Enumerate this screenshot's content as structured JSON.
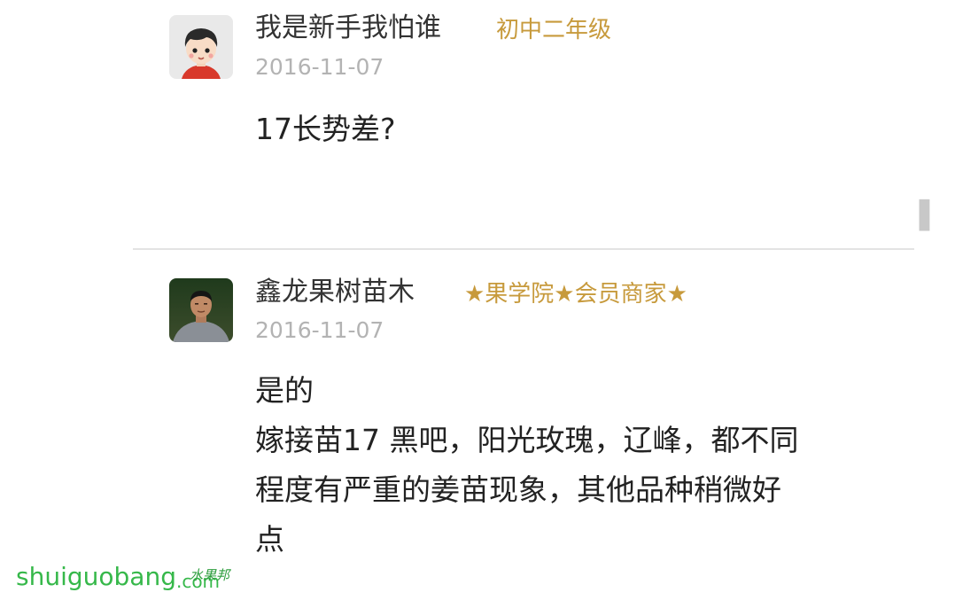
{
  "comments": [
    {
      "username": "我是新手我怕谁",
      "badge": "初中二年级",
      "date": "2016-11-07",
      "body": [
        "17长势差?"
      ],
      "avatar_icon": "cartoon-boy-avatar"
    },
    {
      "username": "鑫龙果树苗木",
      "badge": "★果学院★会员商家★",
      "date": "2016-11-07",
      "body": [
        "是的",
        "嫁接苗17 黑吧，阳光玫瑰，辽峰，都不同",
        "程度有严重的姜苗现象，其他品种稍微好",
        "点"
      ],
      "avatar_icon": "man-photo-avatar"
    }
  ],
  "watermark": {
    "site": "shuiguobang",
    "tld": ".com",
    "brand_cn": "水果邦"
  },
  "colors": {
    "badge": "#c79a3c",
    "date": "#b3b3b3",
    "text": "#222222",
    "watermark": "#36b84a"
  }
}
